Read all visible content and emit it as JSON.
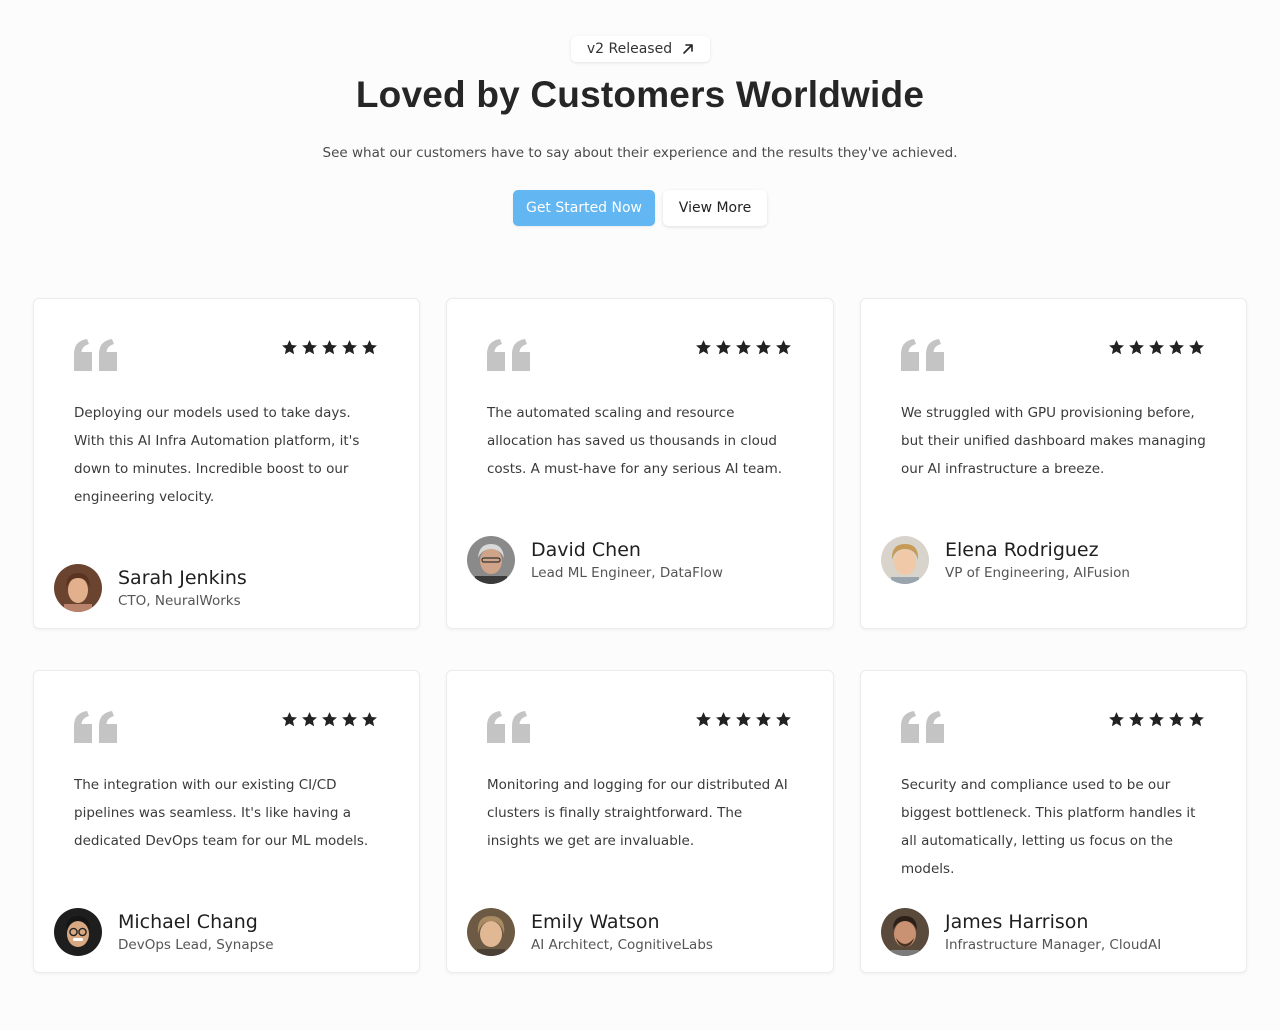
{
  "badge": {
    "label": "v2 Released",
    "icon": "arrow-up-right-icon"
  },
  "header": {
    "title": "Loved by Customers Worldwide",
    "subtitle": "See what our customers have to say about their experience and the results they've achieved."
  },
  "actions": {
    "primary_label": "Get Started Now",
    "secondary_label": "View More"
  },
  "colors": {
    "accent": "#62b6f1",
    "quote_icon": "#c4c4c4",
    "star": "#222222"
  },
  "testimonials": [
    {
      "rating": 5,
      "quote": "Deploying our models used to take days. With this AI Infra Automation platform, it's down to minutes. Incredible boost to our engineering velocity.",
      "name": "Sarah Jenkins",
      "role": "CTO, NeuralWorks"
    },
    {
      "rating": 5,
      "quote": "The automated scaling and resource allocation has saved us thousands in cloud costs. A must-have for any serious AI team.",
      "name": "David Chen",
      "role": "Lead ML Engineer, DataFlow"
    },
    {
      "rating": 5,
      "quote": "We struggled with GPU provisioning before, but their unified dashboard makes managing our AI infrastructure a breeze.",
      "name": "Elena Rodriguez",
      "role": "VP of Engineering, AIFusion"
    },
    {
      "rating": 5,
      "quote": "The integration with our existing CI/CD pipelines was seamless. It's like having a dedicated DevOps team for our ML models.",
      "name": "Michael Chang",
      "role": "DevOps Lead, Synapse"
    },
    {
      "rating": 5,
      "quote": "Monitoring and logging for our distributed AI clusters is finally straightforward. The insights we get are invaluable.",
      "name": "Emily Watson",
      "role": "AI Architect, CognitiveLabs"
    },
    {
      "rating": 5,
      "quote": "Security and compliance used to be our biggest bottleneck. This platform handles it all automatically, letting us focus on the models.",
      "name": "James Harrison",
      "role": "Infrastructure Manager, CloudAI"
    }
  ]
}
